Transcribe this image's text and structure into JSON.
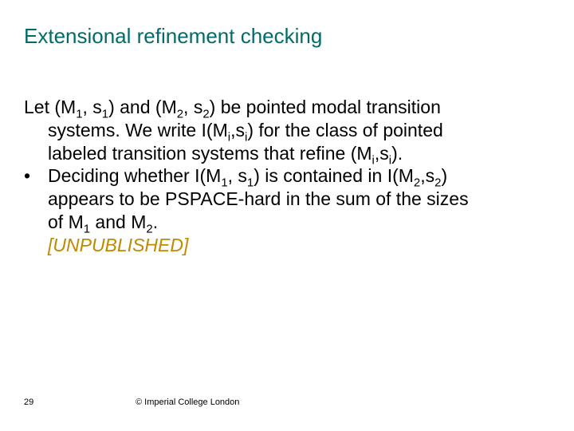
{
  "title": "Extensional refinement checking",
  "para1_lead": "Let (M",
  "para1_rest_a": ", s",
  "para1_rest_b": ") and (M",
  "para1_rest_c": ", s",
  "para1_rest_d": ") be pointed modal transition systems. We write I(M",
  "para1_rest_e": ",s",
  "para1_rest_f": ") for the class of pointed labeled transition systems that refine (M",
  "para1_rest_g": ",s",
  "para1_rest_h": ").",
  "bullet_mark": "•",
  "bullet_a": "Deciding whether I(M",
  "bullet_b": ", s",
  "bullet_c": ") is contained in I(M",
  "bullet_d": ",s",
  "bullet_e": ") appears to be PSPACE-hard in the sum of the sizes of M",
  "bullet_f": " and M",
  "bullet_g": ".",
  "unpublished": "[UNPUBLISHED]",
  "sub1": "1",
  "sub2": "2",
  "subi": "i",
  "page_number": "29",
  "footer": "© Imperial College London"
}
